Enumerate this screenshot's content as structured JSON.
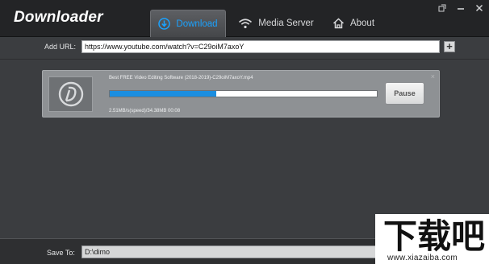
{
  "app": {
    "title": "Downloader"
  },
  "tabs": [
    {
      "label": "Download",
      "icon": "download-icon",
      "active": true
    },
    {
      "label": "Media Server",
      "icon": "wifi-icon",
      "active": false
    },
    {
      "label": "About",
      "icon": "home-icon",
      "active": false
    }
  ],
  "window_controls": [
    "restore-icon",
    "minimize-icon",
    "close-icon"
  ],
  "url_bar": {
    "label": "Add URL:",
    "value": "https://www.youtube.com/watch?v=C29oiM7axoY",
    "add_button": "+"
  },
  "download_item": {
    "file_name": "Best FREE Video Editing Software (2018-2019)-C29oiM7axoY.mp4",
    "progress": 0.4,
    "speed_text": "2.51MB/s(speed)/34.38MB 00:08",
    "pause_label": "Pause",
    "close_symbol": "×"
  },
  "save_to": {
    "label": "Save To:",
    "value": "D:\\dimo"
  },
  "watermark": {
    "brand": "下载吧",
    "url": "www.xiazaiba.com"
  },
  "colors": {
    "accent": "#1b8ee0",
    "titlebar": "#232426",
    "body": "#3b3d40",
    "card": "#8e9194"
  }
}
